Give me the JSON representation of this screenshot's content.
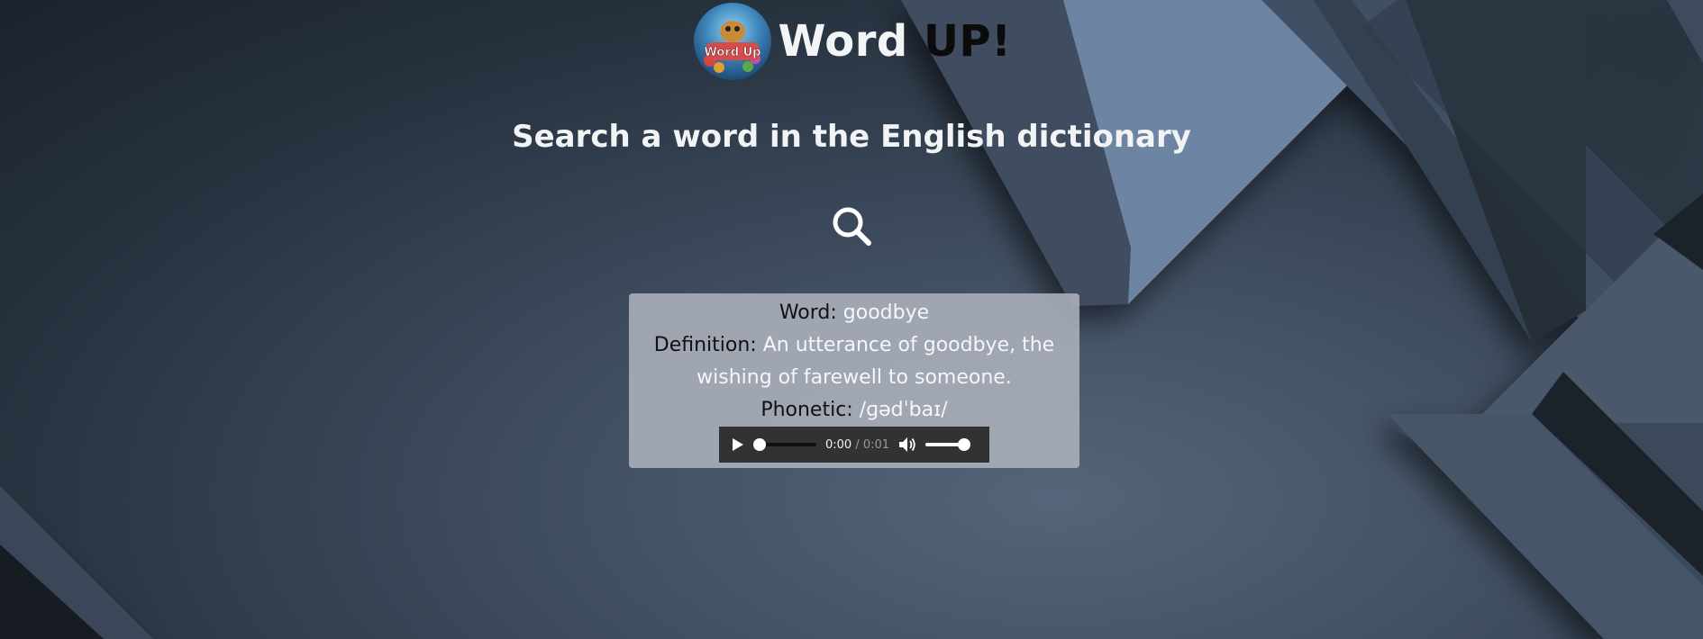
{
  "header": {
    "title_main": "Word ",
    "title_accent": "UP!",
    "logo_text": "Word Up"
  },
  "subtitle": "Search a word in the English dictionary",
  "result": {
    "word_label": "Word:",
    "word_value": "goodbye",
    "definition_label": "Definition:",
    "definition_value": "An utterance of goodbye, the wishing of farewell to someone.",
    "phonetic_label": "Phonetic:",
    "phonetic_value": "/ɡədˈbaɪ/"
  },
  "audio": {
    "current_time": "0:00",
    "duration": "0:01",
    "progress": 0,
    "volume": 1
  },
  "icons": {
    "search": "magnifier-icon",
    "play": "play-icon",
    "volume": "speaker-icon"
  },
  "colors": {
    "title_text": "#f3f4f6",
    "title_accent": "#0b0b0b",
    "card_background": "#acb2bc",
    "value_text": "#f5f6f8",
    "player_background": "#313232"
  }
}
